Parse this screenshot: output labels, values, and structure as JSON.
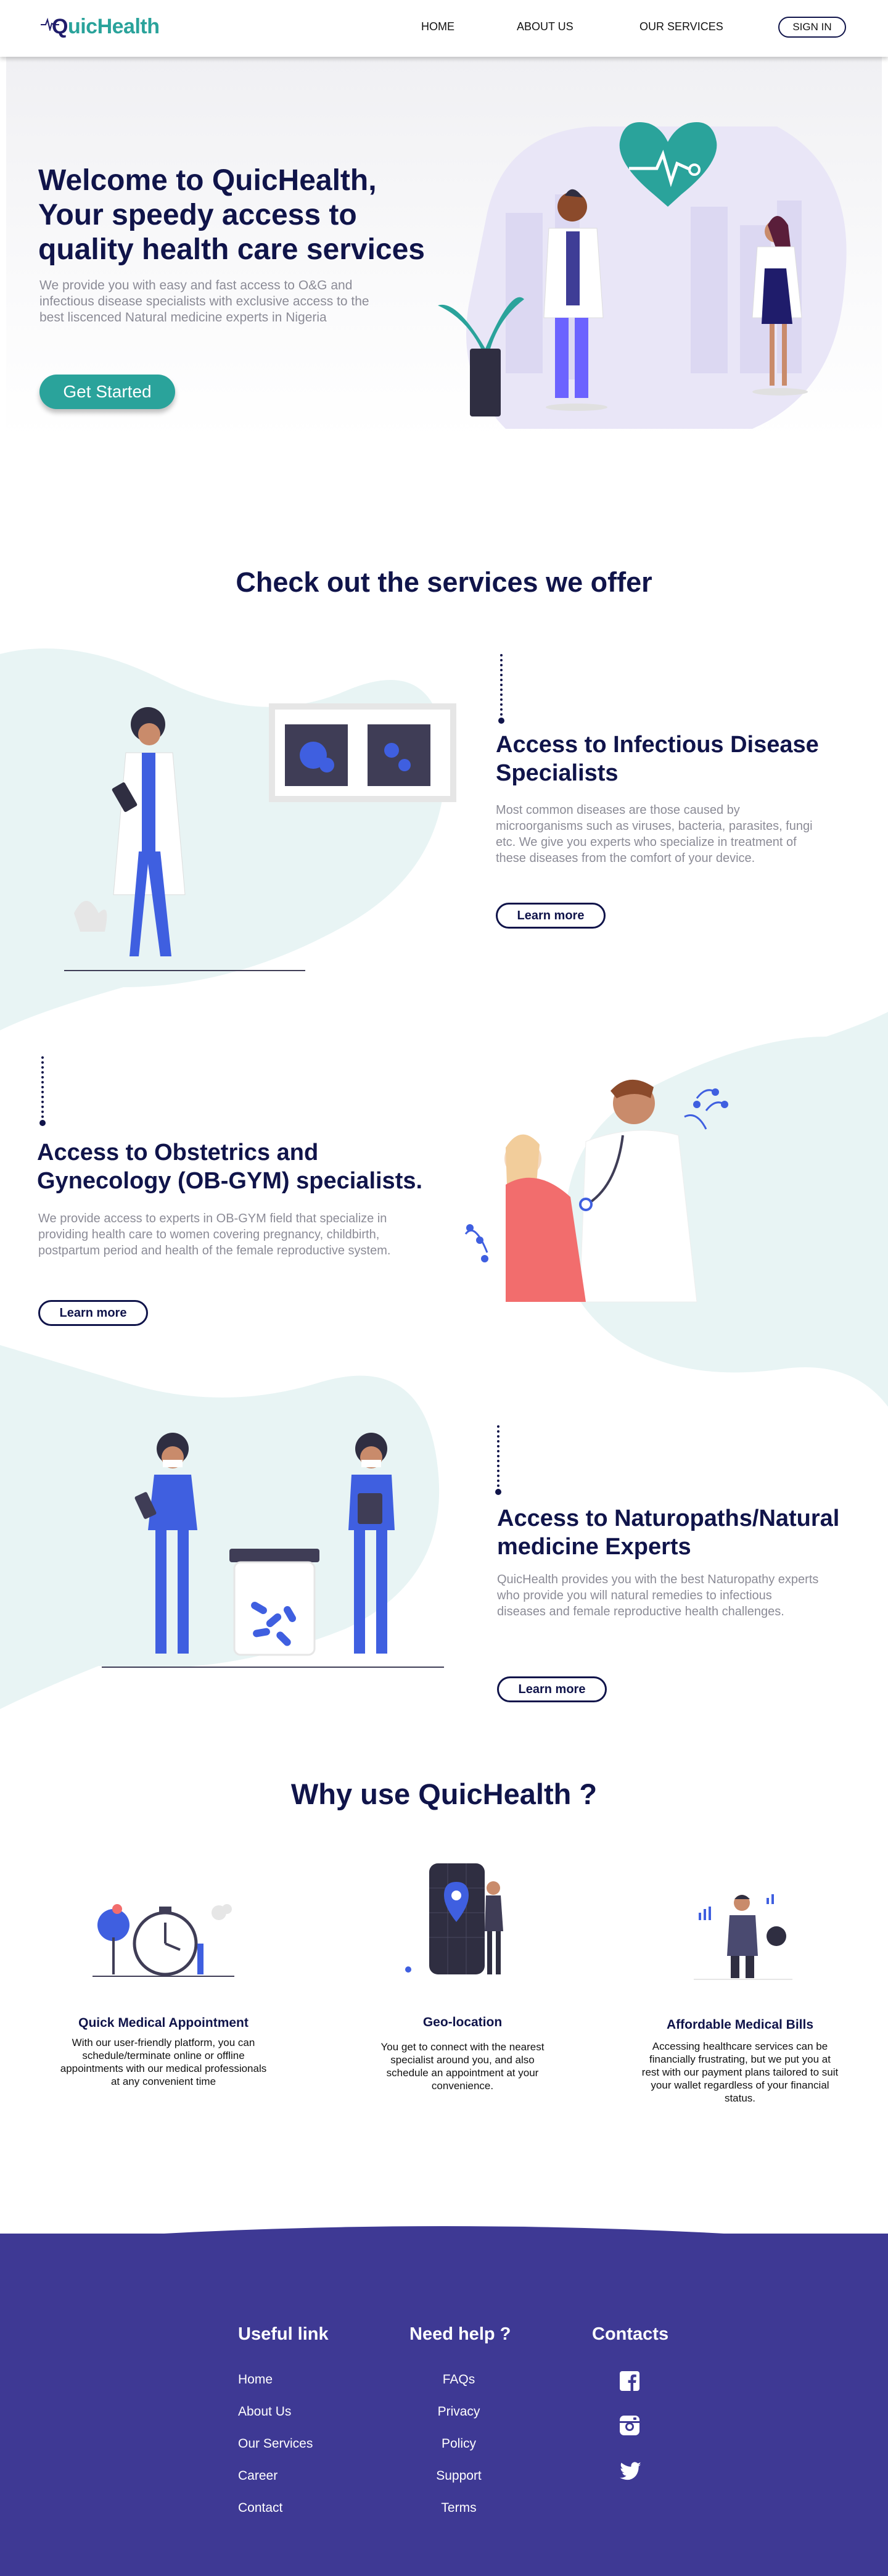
{
  "brand": {
    "logo_text": "QuicHealth",
    "logo_first": "Q",
    "logo_rest": "uicHealth"
  },
  "nav": {
    "home": "HOME",
    "about": "ABOUT US",
    "services": "OUR SERVICES",
    "sign_in": "SIGN IN"
  },
  "hero": {
    "title": "Welcome to QuicHealth, Your speedy access to quality health care services",
    "text": "We provide you with easy and fast access to O&G and infectious disease specialists with exclusive access to the best liscenced Natural medicine experts in Nigeria",
    "cta": "Get Started"
  },
  "services": {
    "heading": "Check out the services we offer",
    "items": [
      {
        "title": "Access to Infectious Disease Specialists",
        "text": "Most common diseases are those caused by microorganisms such as viruses, bacteria, parasites, fungi etc. We give you experts who specialize in treatment of these diseases from the comfort of your device.",
        "button": "Learn more"
      },
      {
        "title": "Access to Obstetrics and Gynecology (OB-GYM) specialists.",
        "text": "We provide access to experts in OB-GYM field that specialize in providing health care to women covering pregnancy, childbirth, postpartum period and health of the female reproductive system.",
        "button": "Learn more"
      },
      {
        "title": "Access to Naturopaths/Natural medicine Experts",
        "text": " QuicHealth provides you with the best Naturopathy experts who provide you will natural remedies to infectious diseases and female reproductive health challenges.",
        "button": "Learn more"
      }
    ]
  },
  "why": {
    "heading": "Why use QuicHealth ?",
    "items": [
      {
        "title": "Quick Medical Appointment",
        "text": "With our user-friendly platform, you can schedule/terminate online or offline appointments with our medical professionals at any convenient time"
      },
      {
        "title": "Geo-location",
        "text": "You get to connect with the nearest specialist around you, and also schedule an appointment at your convenience."
      },
      {
        "title": "Affordable Medical Bills",
        "text": "Accessing healthcare services can be financially frustrating, but we put you at rest with our payment plans tailored to suit your wallet regardless of your financial status."
      }
    ]
  },
  "footer": {
    "useful_heading": "Useful link",
    "useful_links": [
      "Home",
      "About Us",
      "Our Services",
      "Career",
      "Contact"
    ],
    "help_heading": "Need help ?",
    "help_links": [
      "FAQs",
      "Privacy",
      "Policy",
      "Support",
      "Terms"
    ],
    "contacts_heading": "Contacts",
    "contact_icons": [
      "facebook-icon",
      "instagram-icon",
      "twitter-icon"
    ]
  },
  "colors": {
    "primary": "#10144a",
    "accent": "#2aa39b",
    "footer": "#3e3994",
    "illustration_blue": "#3f5fe0"
  }
}
